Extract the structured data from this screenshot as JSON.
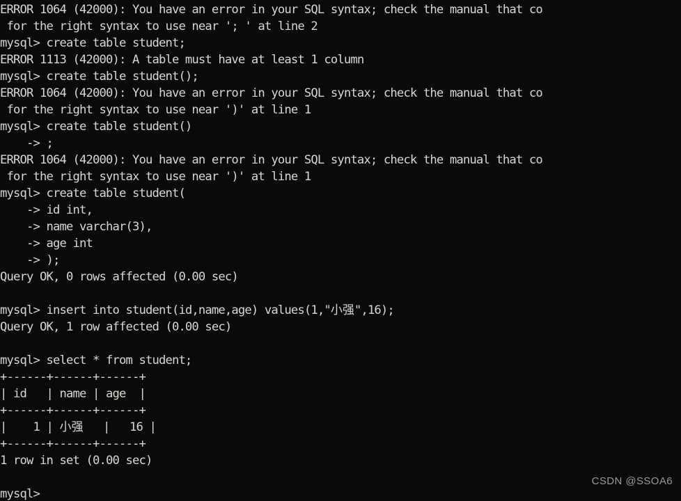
{
  "terminal": {
    "background_color": "#0a0a0a",
    "foreground_color": "#d8d8d0",
    "prompt": "mysql>",
    "continuation_prompt": "->",
    "lines": [
      "ERROR 1064 (42000): You have an error in your SQL syntax; check the manual that co",
      " for the right syntax to use near '; ' at line 2",
      "mysql> create table student;",
      "ERROR 1113 (42000): A table must have at least 1 column",
      "mysql> create table student();",
      "ERROR 1064 (42000): You have an error in your SQL syntax; check the manual that co",
      " for the right syntax to use near ')' at line 1",
      "mysql> create table student()",
      "    -> ;",
      "ERROR 1064 (42000): You have an error in your SQL syntax; check the manual that co",
      " for the right syntax to use near ')' at line 1",
      "mysql> create table student(",
      "    -> id int,",
      "    -> name varchar(3),",
      "    -> age int",
      "    -> );",
      "Query OK, 0 rows affected (0.00 sec)",
      "",
      "mysql> insert into student(id,name,age) values(1,\"小强\",16);",
      "Query OK, 1 row affected (0.00 sec)",
      "",
      "mysql> select * from student;",
      "+------+------+------+",
      "| id   | name | age  |",
      "+------+------+------+",
      "|    1 | 小强   |   16 |",
      "+------+------+------+",
      "1 row in set (0.00 sec)",
      "",
      "mysql>"
    ]
  },
  "errors": [
    {
      "code": "1064",
      "sqlstate": "42000",
      "message": "You have an error in your SQL syntax; check the manual that co",
      "detail": " for the right syntax to use near '; ' at line 2"
    },
    {
      "code": "1113",
      "sqlstate": "42000",
      "message": "A table must have at least 1 column",
      "detail": ""
    },
    {
      "code": "1064",
      "sqlstate": "42000",
      "message": "You have an error in your SQL syntax; check the manual that co",
      "detail": " for the right syntax to use near ')' at line 1"
    },
    {
      "code": "1064",
      "sqlstate": "42000",
      "message": "You have an error in your SQL syntax; check the manual that co",
      "detail": " for the right syntax to use near ')' at line 1"
    }
  ],
  "commands": [
    "create table student;",
    "create table student();",
    "create table student()",
    "create table student(",
    "insert into student(id,name,age) values(1,\"小强\",16);",
    "select * from student;"
  ],
  "result_table": {
    "columns": [
      "id",
      "name",
      "age"
    ],
    "rows": [
      [
        "1",
        "小强",
        "16"
      ]
    ],
    "status": "1 row in set (0.00 sec)"
  },
  "statuses": [
    "Query OK, 0 rows affected (0.00 sec)",
    "Query OK, 1 row affected (0.00 sec)",
    "1 row in set (0.00 sec)"
  ],
  "watermark": {
    "text": "CSDN @SSOA6",
    "color": "#9a9a9a"
  }
}
